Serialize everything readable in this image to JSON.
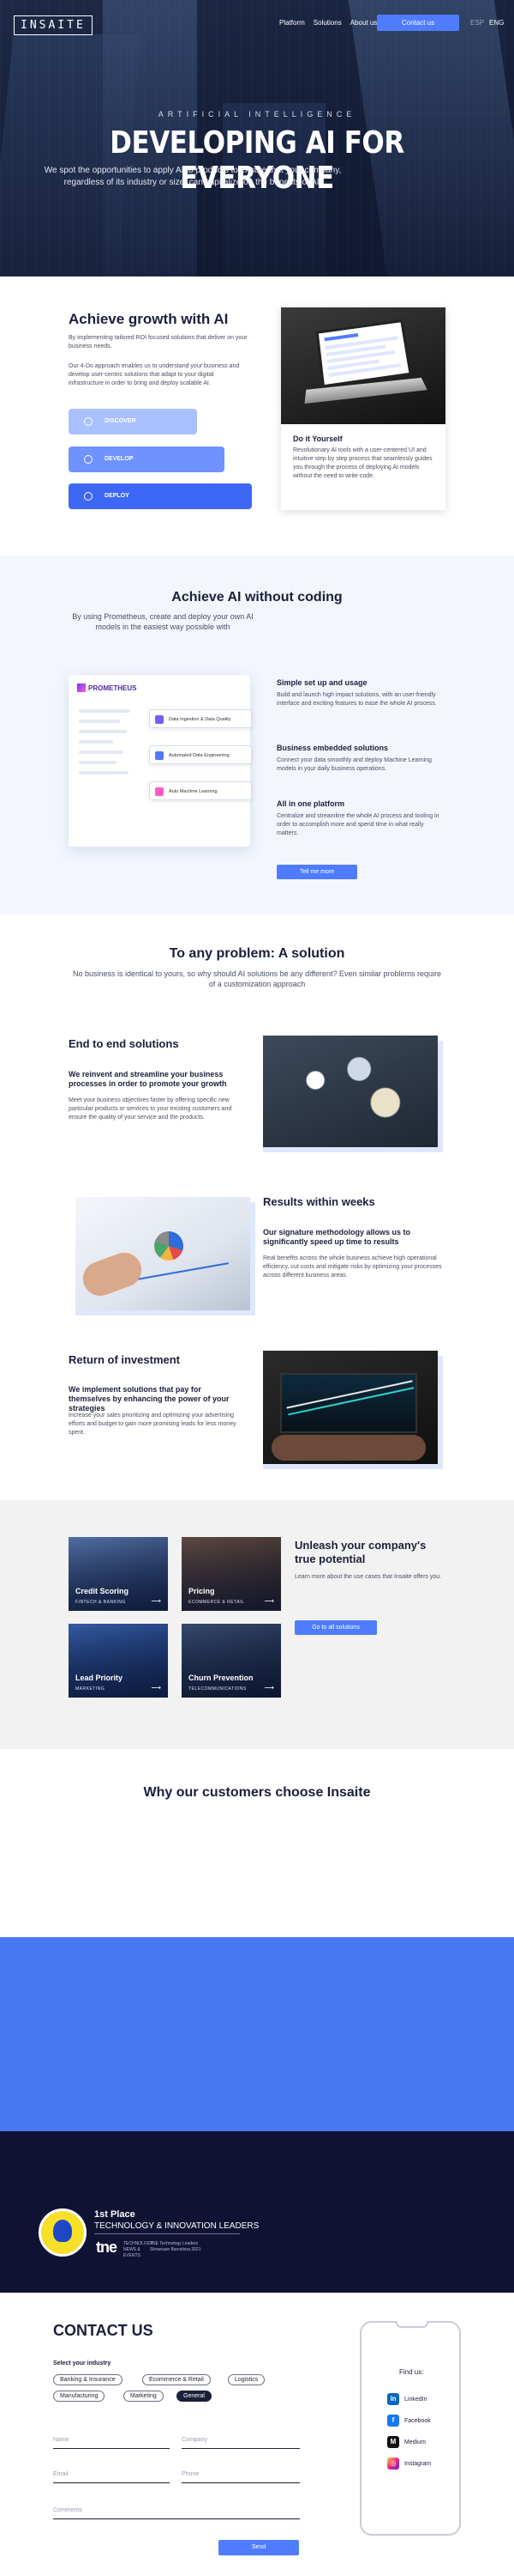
{
  "header": {
    "logo": "INSAITE",
    "nav": [
      "Platform",
      "Solutions",
      "About us"
    ],
    "contact_label": "Contact us",
    "lang_esp": "ESP",
    "lang_eng": "ENG"
  },
  "hero": {
    "kicker": "ARTIFICIAL INTELLIGENCE",
    "title": "DEVELOPING AI FOR EVERYONE",
    "subtitle": "We spot the opportunities to apply AI to products to ensure that your company, regardless of its industry or size, can capitalize on the benefits of AI."
  },
  "growth": {
    "title": "Achieve growth with AI",
    "p1": "By implementing tailored ROI focused solutions that deliver on your business needs.",
    "p2": "Our 4-Do approach enables us to understand your business and develop user-centric solutions that adapt to your digital infrastructure in order to bring and deploy scalable AI.",
    "steps": [
      "DISCOVER",
      "DEVELOP",
      "DEPLOY"
    ],
    "card_title": "Do it Yourself",
    "card_text": "Revolutionary AI tools with a user-centered UI and intuitive step by step process that seamlessly guides you through the process of deploying AI models without the need to write code."
  },
  "nocode": {
    "title": "Achieve AI without coding",
    "subtitle": "By using Prometheus, create and deploy your own AI models in the easiest way possible with",
    "prom_logo": "PROMETHEUS",
    "pills": [
      "Data Ingestion & Data Quality",
      "Automated Data Engineering",
      "Auto Machine Learning"
    ],
    "features": [
      {
        "title": "Simple set up and usage",
        "text": "Build and launch high impact solutions, with an user-friendly interface and exciting features to ease the whole AI process."
      },
      {
        "title": "Business embedded solutions",
        "text": "Connect your data smoothly and deploy Machine Learning models in your daily business operations."
      },
      {
        "title": "All in one platform",
        "text": "Centralize and streamline the whole AI process and tooling in order to accomplish more and spend time in what really matters."
      }
    ],
    "cta": "Tell me more"
  },
  "solution": {
    "title": "To any problem: A solution",
    "subtitle": "No business is identical to yours, so why should AI solutions be any different? Even similar problems require of a customization approach",
    "blocks": [
      {
        "title": "End to end solutions",
        "strong": "We reinvent and streamline your business processes in order to promote your growth",
        "text": "Meet your business objectives faster by offering specific new particular products or services to your existing customers and ensure the quality of your service and the products."
      },
      {
        "title": "Results within weeks",
        "strong": "Our signature methodology allows us to significantly speed up time to results",
        "text": "Real benefits across the whole business achieve high operational efficiency, cut costs and mitigate risks by optimizing your processes across different business areas."
      },
      {
        "title": "Return of investment",
        "strong": "We implement solutions that pay for themselves by enhancing the power of your strategies",
        "text": "Increase your sales prioritizing and optimizing your advertising efforts and budget to gain more promising leads for less money spent."
      }
    ]
  },
  "cases": {
    "tiles": [
      {
        "name": "Credit Scoring",
        "category": "FINTECH & BANKING"
      },
      {
        "name": "Pricing",
        "category": "ECOMMERCE & RETAIL"
      },
      {
        "name": "Lead Priority",
        "category": "MARKETING"
      },
      {
        "name": "Churn Prevention",
        "category": "TELECOMMUNICATIONS"
      }
    ],
    "arrow": "⟶",
    "title": "Unleash your company's true potential",
    "text": "Learn more about the use cases that Insaite offers you.",
    "cta": "Go to all solutions"
  },
  "why": {
    "title": "Why our customers choose Insaite"
  },
  "award": {
    "place": "1st Place",
    "text": "TECHNOLOGY & INNOVATION LEADERS",
    "tne": "tne",
    "tne_sub": "TECHNOLOGY NEWS & EVENTS",
    "tne_small": "TNE Technology Leaders Showcase Barcelona 2021"
  },
  "contact": {
    "title": "CONTACT US",
    "industry_label": "Select your industry",
    "industries": [
      "Banking & Insurance",
      "Ecommerce & Retail",
      "Logistics",
      "Manufacturing",
      "Marketing",
      "General"
    ],
    "active_industry": "General",
    "fields": {
      "name": "Name",
      "company": "Company",
      "email": "Email",
      "phone": "Phone",
      "comments": "Comments"
    },
    "send": "Send",
    "find_us": "Find us:",
    "socials": [
      "LinkedIn",
      "Facebook",
      "Medium",
      "Instagram"
    ]
  },
  "colors": {
    "accent": "#4f7cff",
    "dark": "#101233",
    "band": "#4a78f2"
  }
}
